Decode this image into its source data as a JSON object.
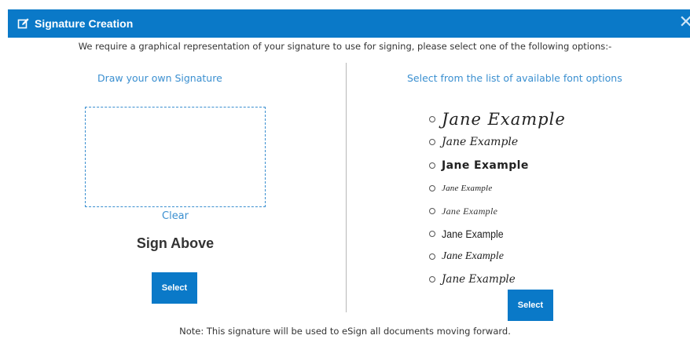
{
  "dialog": {
    "title": "Signature Creation",
    "icon": "edit-icon",
    "close_glyph": "✕",
    "instruction": "We require a graphical representation of your signature to use for signing, please select one of the following options:-",
    "note": "Note: This signature will be used to eSign all documents moving forward."
  },
  "draw_panel": {
    "heading": "Draw your own Signature",
    "clear_label": "Clear",
    "sign_above": "Sign Above",
    "select_label": "Select"
  },
  "font_panel": {
    "heading": "Select from the list of available font options",
    "options": [
      {
        "label": "Jane Example"
      },
      {
        "label": "Jane Example"
      },
      {
        "label": "Jane Example"
      },
      {
        "label": "Jane Example"
      },
      {
        "label": "Jane Example"
      },
      {
        "label": "Jane Example"
      },
      {
        "label": "Jane Example"
      },
      {
        "label": "Jane Example"
      }
    ],
    "select_label": "Select"
  },
  "colors": {
    "accent": "#0a79c8",
    "link": "#3a8fd0"
  }
}
